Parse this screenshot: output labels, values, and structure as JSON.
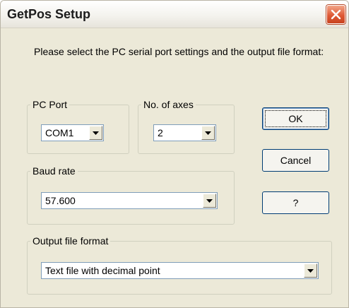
{
  "window": {
    "title": "GetPos Setup"
  },
  "instruction": "Please select the PC serial port settings and the output file format:",
  "pc_port": {
    "label": "PC Port",
    "value": "COM1"
  },
  "axes": {
    "label": "No. of axes",
    "value": "2"
  },
  "baud": {
    "label": "Baud rate",
    "value": "57.600"
  },
  "output": {
    "label": "Output file format",
    "value": "Text file with decimal point"
  },
  "buttons": {
    "ok": "OK",
    "cancel": "Cancel",
    "help": "?"
  },
  "icons": {
    "close": "close-icon",
    "dropdown": "chevron-down-icon"
  },
  "colors": {
    "dialog_bg": "#ece9d8",
    "close_button": "#df5a36",
    "button_border": "#003c74"
  }
}
